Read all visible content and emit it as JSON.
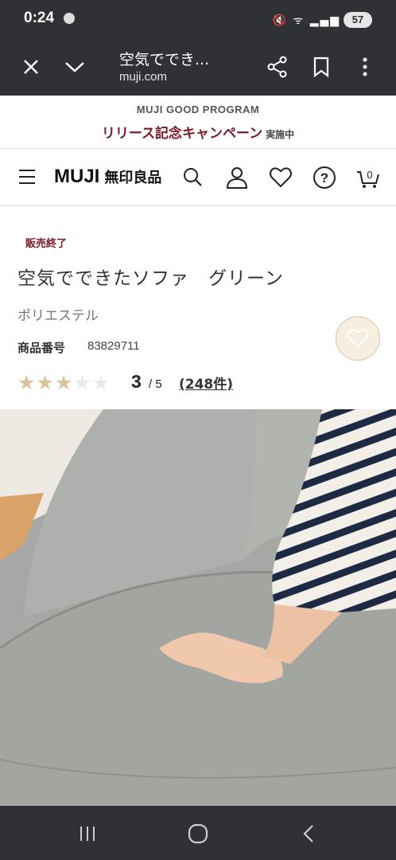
{
  "status_bar": {
    "time": "0:24",
    "battery": "57"
  },
  "browser": {
    "tab_title": "空気ででき...",
    "domain": "muji.com"
  },
  "promo": {
    "program": "MUJI GOOD PROGRAM",
    "campaign": "リリース記念キャンペーン",
    "campaign_status": "実施中"
  },
  "header": {
    "logo_en": "MUJI",
    "logo_jp": "無印良品",
    "cart_count": "0"
  },
  "product": {
    "badge": "販売終了",
    "name": "空気でできたソファ　グリーン",
    "material": "ポリエステル",
    "sku_label": "商品番号",
    "sku": "83829711",
    "rating": 3,
    "rating_max": 5,
    "rating_text": "3",
    "rating_suffix": "/ 5",
    "review_count": "(248件)"
  },
  "colors": {
    "status_bg": "#2f3135",
    "brand_red": "#7a1a2a",
    "star_on": "#d9c49b",
    "star_off": "#e8e8e8"
  },
  "icons": [
    "close-icon",
    "chevron-down-icon",
    "share-icon",
    "bookmark-icon",
    "more-vert-icon",
    "menu-icon",
    "search-icon",
    "user-icon",
    "heart-icon",
    "help-icon",
    "cart-icon",
    "recents-icon",
    "home-icon",
    "back-icon"
  ]
}
